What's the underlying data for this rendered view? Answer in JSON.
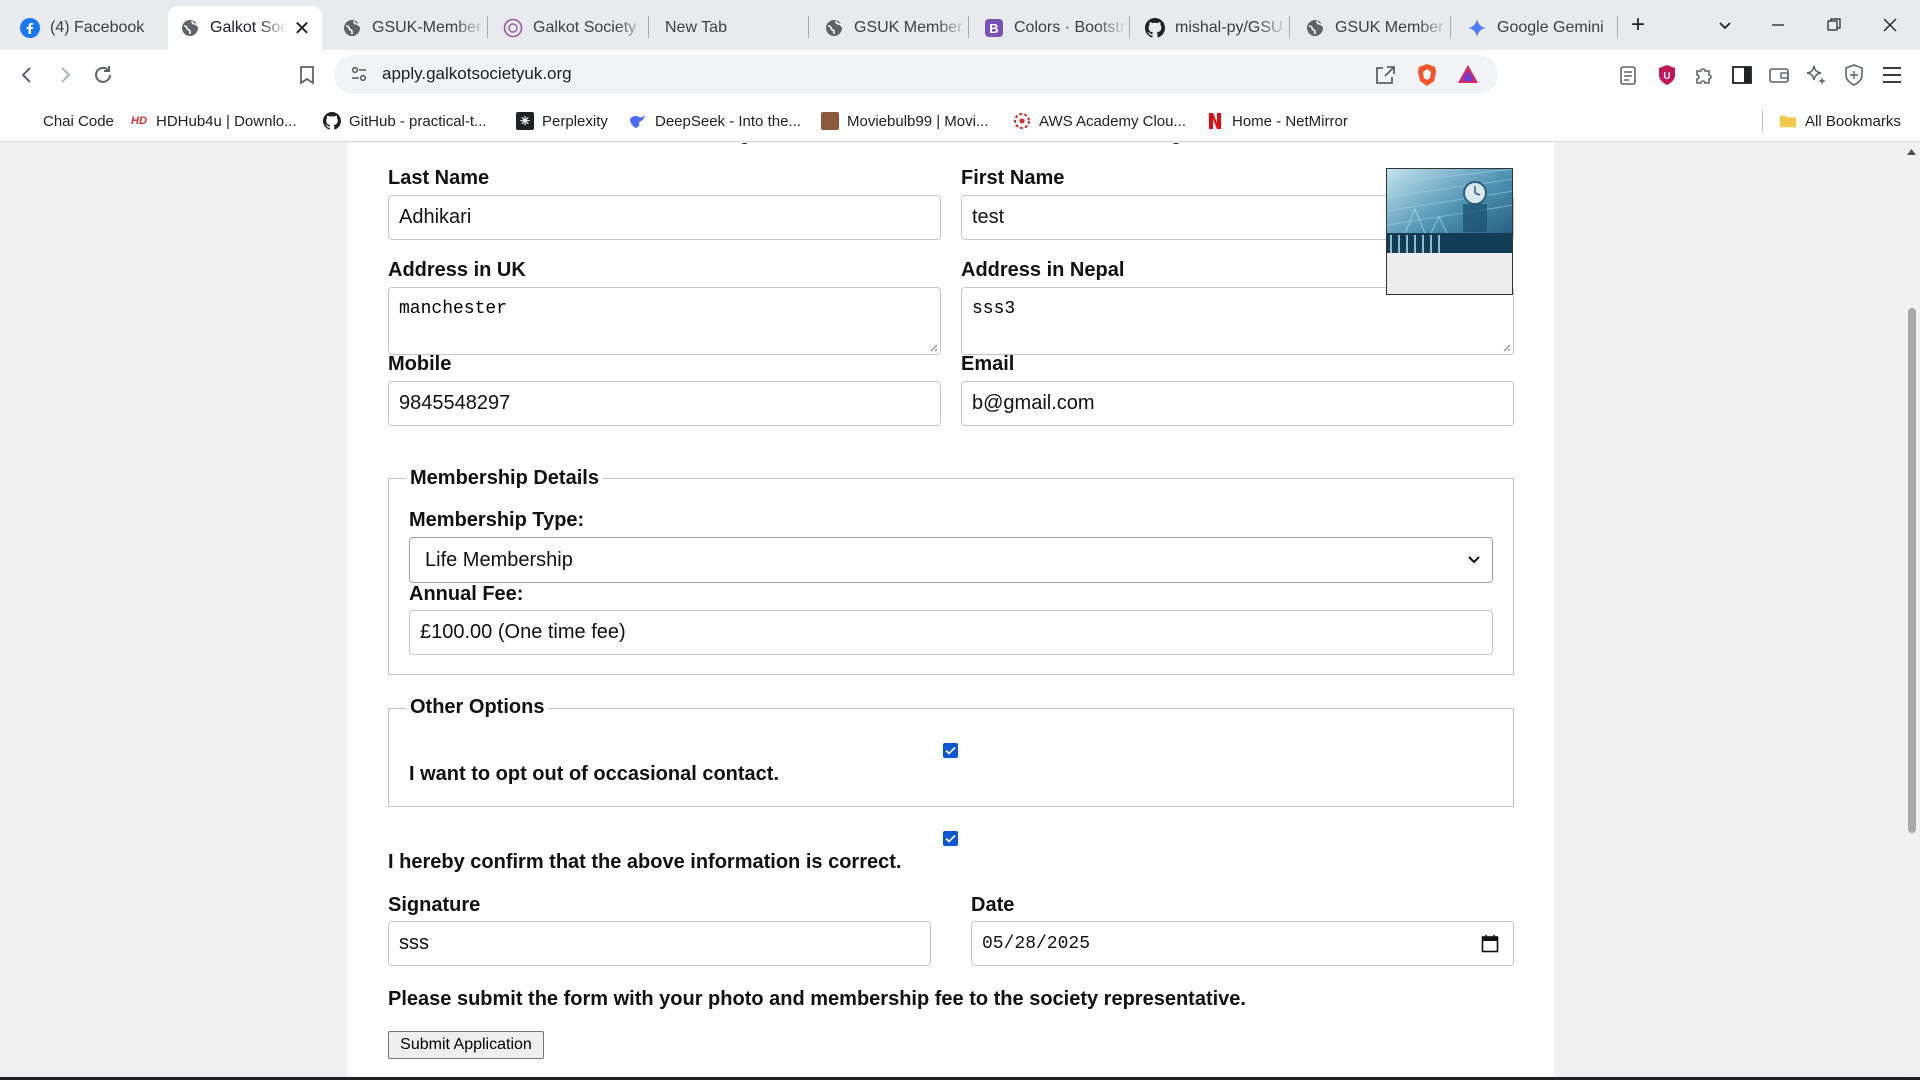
{
  "browser": {
    "tabs": [
      {
        "title": "(4) Facebook",
        "icon": "facebook-icon"
      },
      {
        "title": "Galkot Soc",
        "icon": "globe-icon",
        "active": true
      },
      {
        "title": "GSUK-Member",
        "icon": "globe-icon"
      },
      {
        "title": "Galkot Society",
        "icon": "galkot-logo-icon"
      },
      {
        "title": "New Tab",
        "icon": ""
      },
      {
        "title": "GSUK Member",
        "icon": "globe-icon"
      },
      {
        "title": "Colors · Bootstr",
        "icon": "bootstrap-icon"
      },
      {
        "title": "mishal-py/GSU",
        "icon": "github-icon"
      },
      {
        "title": "GSUK Member",
        "icon": "globe-icon"
      },
      {
        "title": "Google Gemini",
        "icon": "gemini-icon"
      }
    ],
    "url": "apply.galkotsocietyuk.org",
    "bookmarks": [
      {
        "label": "Chai Code",
        "icon": ""
      },
      {
        "label": "HDHub4u | Downlo...",
        "icon": "hd-icon"
      },
      {
        "label": "GitHub - practical-t...",
        "icon": "github-icon"
      },
      {
        "label": "Perplexity",
        "icon": "perplexity-icon"
      },
      {
        "label": "DeepSeek - Into the...",
        "icon": "deepseek-icon"
      },
      {
        "label": "Moviebulb99 | Movi...",
        "icon": "movie-icon"
      },
      {
        "label": "AWS Academy Clou...",
        "icon": "aws-icon"
      },
      {
        "label": "Home - NetMirror",
        "icon": "netmirror-icon"
      }
    ],
    "all_bookmarks": "All Bookmarks",
    "colors": {
      "tabstrip": "#e8eaed",
      "toolbar": "#ffffff",
      "checkbox": "#0b57d0"
    }
  },
  "form": {
    "last_name_label": "Last Name",
    "last_name_value": "Adhikari",
    "first_name_label": "First Name",
    "first_name_value": "test",
    "address_uk_label": "Address in UK",
    "address_uk_value": "manchester",
    "address_nepal_label": "Address in Nepal",
    "address_nepal_value": "sss3",
    "mobile_label": "Mobile",
    "mobile_value": "9845548297",
    "email_label": "Email",
    "email_value": "b@gmail.com",
    "membership_legend": "Membership Details",
    "membership_type_label": "Membership Type:",
    "membership_type_value": "Life Membership",
    "annual_fee_label": "Annual Fee:",
    "annual_fee_value": "£100.00 (One time fee)",
    "other_legend": "Other Options",
    "opt_out_label": "I want to opt out of occasional contact.",
    "opt_out_checked": true,
    "confirm_label": "I hereby confirm that the above information is correct.",
    "confirm_checked": true,
    "signature_label": "Signature",
    "signature_value": "sss",
    "date_label": "Date",
    "date_value": "05/28/2025",
    "submit_note": "Please submit the form with your photo and membership fee to the society representative.",
    "submit_button": "Submit Application"
  }
}
